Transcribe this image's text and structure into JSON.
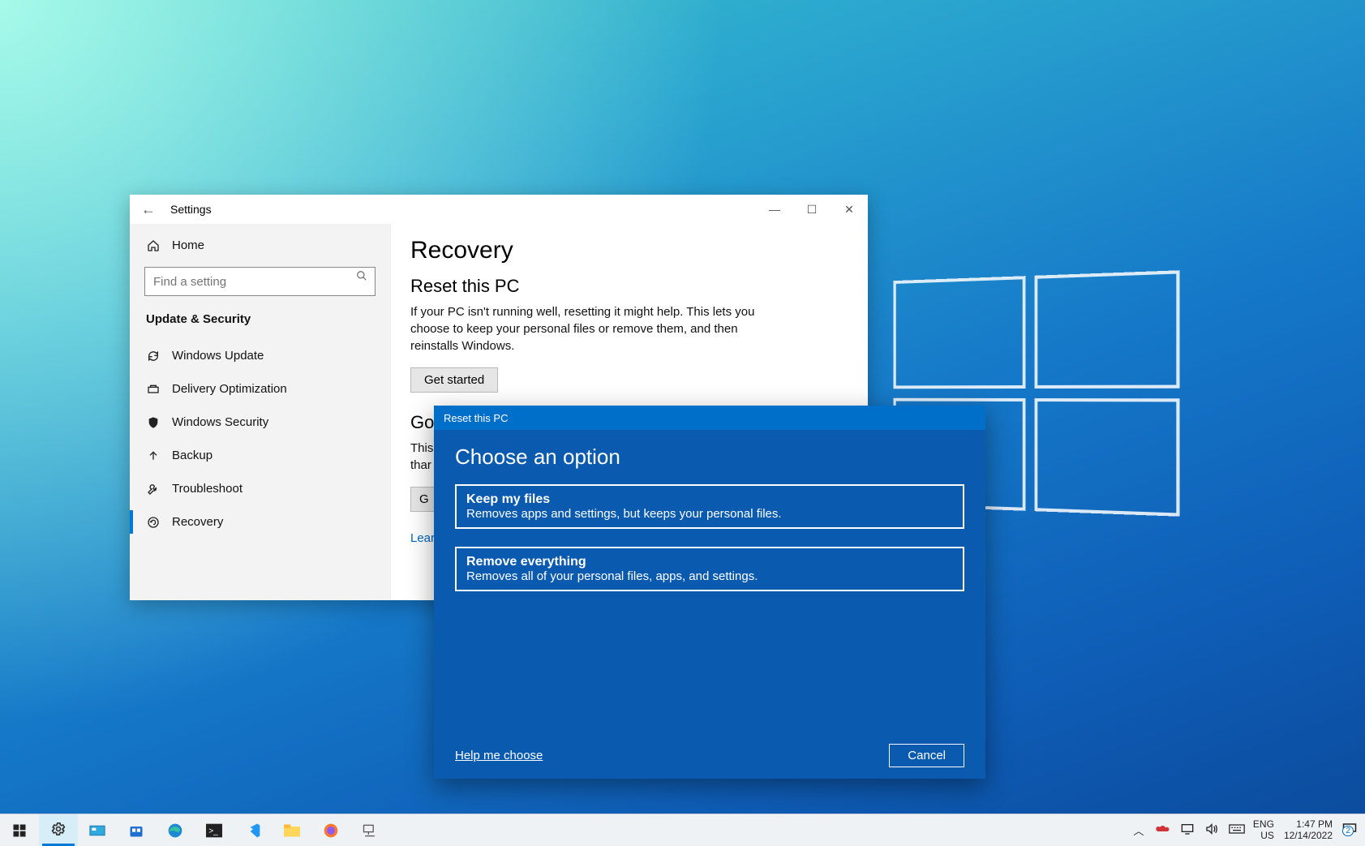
{
  "settings": {
    "title": "Settings",
    "home": "Home",
    "search_placeholder": "Find a setting",
    "group": "Update & Security",
    "items": [
      "Windows Update",
      "Delivery Optimization",
      "Windows Security",
      "Backup",
      "Troubleshoot",
      "Recovery"
    ]
  },
  "recovery": {
    "h1": "Recovery",
    "h2": "Reset this PC",
    "p": "If your PC isn't running well, resetting it might help. This lets you choose to keep your personal files or remove them, and then reinstalls Windows.",
    "btn": "Get started",
    "h2b_partial": "Go",
    "p2_partial": "This\nthar",
    "btn2_partial": "G",
    "link_partial": "Lear"
  },
  "modal": {
    "title": "Reset this PC",
    "heading": "Choose an option",
    "opt1_title": "Keep my files",
    "opt1_sub": "Removes apps and settings, but keeps your personal files.",
    "opt2_title": "Remove everything",
    "opt2_sub": "Removes all of your personal files, apps, and settings.",
    "help": "Help me choose",
    "cancel": "Cancel"
  },
  "taskbar": {
    "lang1": "ENG",
    "lang2": "US",
    "time": "1:47 PM",
    "date": "12/14/2022",
    "notif_count": "2"
  }
}
